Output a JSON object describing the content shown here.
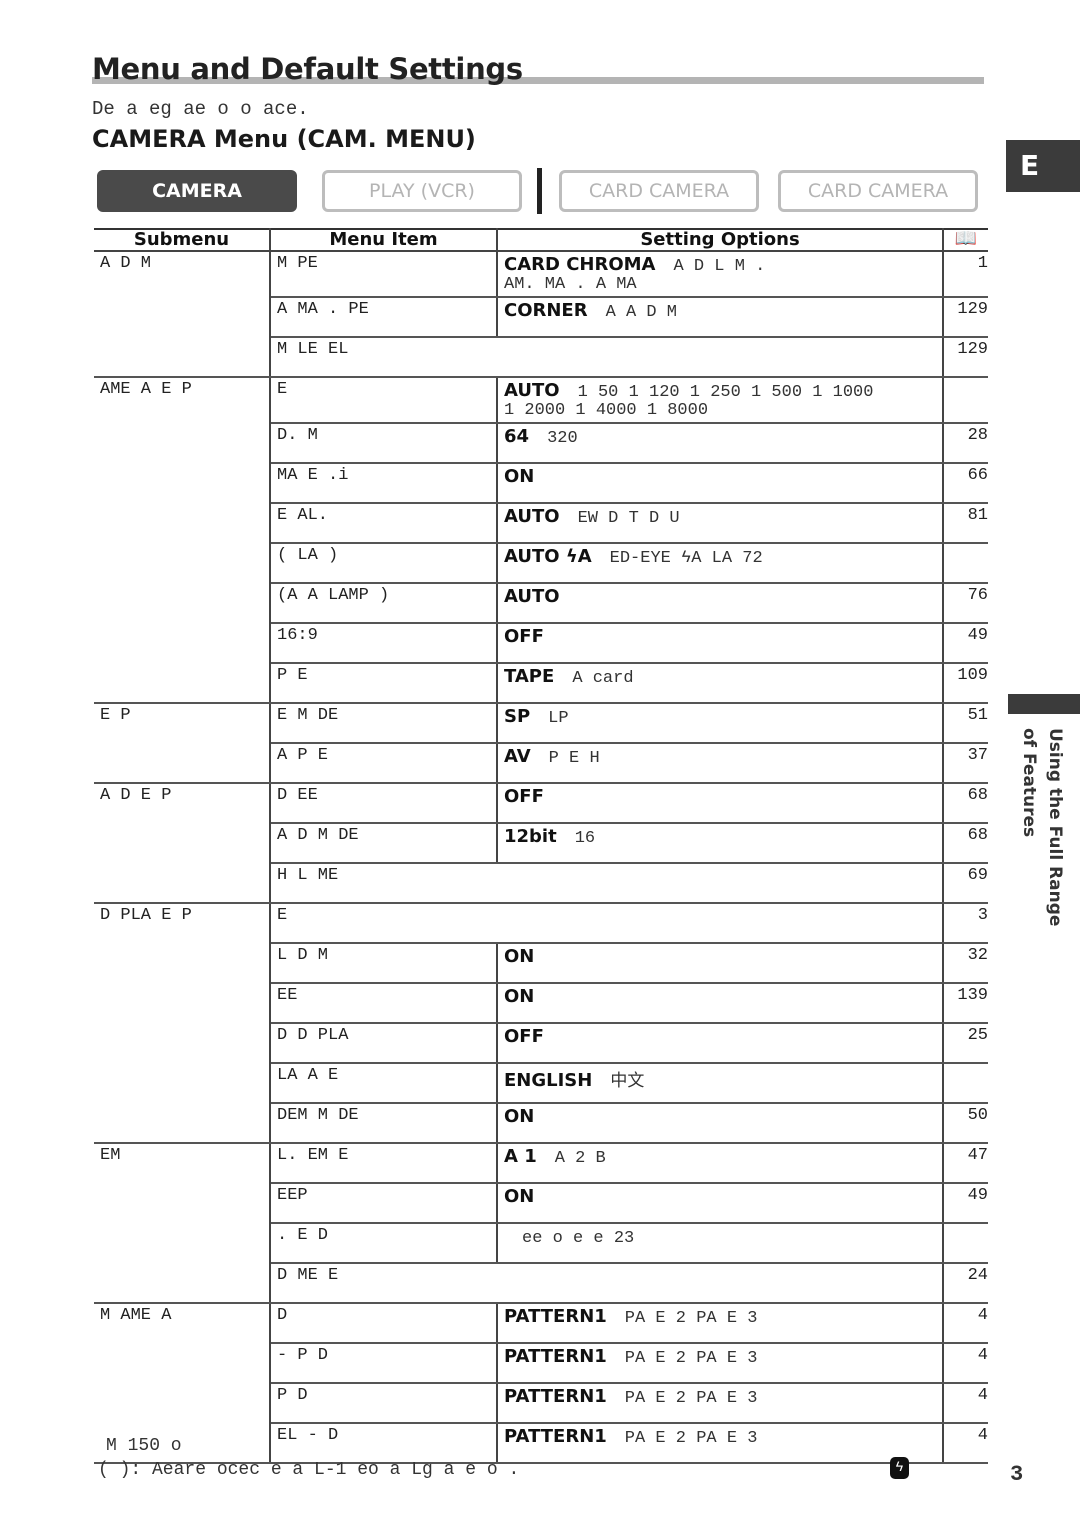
{
  "header": {
    "title": "Menu and Default Settings",
    "subtitle": "De a eg ae o  o ace.",
    "section": "CAMERA Menu (CAM. MENU)"
  },
  "mode_tabs": [
    {
      "label": "CAMERA",
      "active": true
    },
    {
      "label": "PLAY (VCR)",
      "active": false
    },
    {
      "label": "CARD CAMERA",
      "active": false
    },
    {
      "label": "CARD CAMERA",
      "active": false
    }
  ],
  "side": {
    "language_tab": "E",
    "chapter": "Using the Full Range of Features"
  },
  "table": {
    "headers": {
      "submenu": "Submenu",
      "menu_item": "Menu Item",
      "setting_options": "Setting Options",
      "page": "book-icon"
    },
    "groups": [
      {
        "submenu": "A D M",
        "rows": [
          {
            "item": "M     PE",
            "default": "CARD CHROMA",
            "options": "A D L M .",
            "options2": "AM.      MA    . A  MA",
            "page": "1"
          },
          {
            "item": "A  MA .   PE",
            "default": "CORNER",
            "options": "A        A D M",
            "page": "129"
          },
          {
            "item": "M   LE EL",
            "default": "",
            "options": "",
            "page": "129",
            "span": true
          }
        ]
      },
      {
        "submenu": "AME A  E   P",
        "rows": [
          {
            "item": "     E",
            "default": "AUTO",
            "options": "1 50  1 120  1 250  1 500  1 1000",
            "options2": "1 2000  1 4000  1 8000",
            "page": ""
          },
          {
            "item": "D.    M",
            "default": "64",
            "options": "320",
            "page": "28"
          },
          {
            "item": " MA E  .i",
            "default": "ON",
            "options": "",
            "page": "66"
          },
          {
            "item": "    E  AL.",
            "default": "AUTO",
            "options": "EW     D   T      D   U",
            "page": "81"
          },
          {
            "item": "( LA  )",
            "default": "AUTO ϟA",
            "options": "ED-EYE       ϟA          LA 72",
            "page": ""
          },
          {
            "item": "(A  A   LAMP )",
            "default": "AUTO",
            "options": "",
            "page": "76"
          },
          {
            "item": "16:9",
            "default": "OFF",
            "options": "",
            "page": "49"
          },
          {
            "item": "P       E",
            "default": "TAPE",
            "options": "A  card",
            "page": "109"
          }
        ]
      },
      {
        "submenu": "    E   P",
        "rows": [
          {
            "item": "  E  M DE",
            "default": "SP",
            "options": "LP",
            "page": "51"
          },
          {
            "item": "A  P   E",
            "default": "AV",
            "options": "P    E H",
            "page": "37"
          }
        ]
      },
      {
        "submenu": "A D     E   P",
        "rows": [
          {
            "item": "    D    EE",
            "default": "OFF",
            "options": "",
            "page": "68"
          },
          {
            "item": "A D    M DE",
            "default": "12bit",
            "options": "16",
            "page": "68"
          },
          {
            "item": "H   L ME",
            "default": "",
            "options": "",
            "page": "69",
            "span": true
          }
        ]
      },
      {
        "submenu": "D  PLA    E   P",
        "rows": [
          {
            "item": "         E",
            "default": "",
            "options": "",
            "page": "3",
            "span": true
          },
          {
            "item": "L D M",
            "default": "ON",
            "options": "",
            "page": "32"
          },
          {
            "item": "       EE",
            "default": "ON",
            "options": "",
            "page": "139"
          },
          {
            "item": "D   D  PLA",
            "default": "OFF",
            "options": "",
            "page": "25"
          },
          {
            "item": "LA    A E",
            "default": "ENGLISH",
            "options": "中文",
            "page": ""
          },
          {
            "item": "DEM  M DE",
            "default": "ON",
            "options": "",
            "page": "50"
          }
        ]
      },
      {
        "submenu": "    EM",
        "rows": [
          {
            "item": " L.  EM  E",
            "default": "A  1",
            "options": "A  2     B",
            "page": "47"
          },
          {
            "item": " EEP",
            "default": "ON",
            "options": "",
            "page": "49"
          },
          {
            "item": " .   E D",
            "default": "",
            "options": "  ee  o e e                        23",
            "page": ""
          },
          {
            "item": "D   ME  E",
            "default": "",
            "options": "",
            "page": "24",
            "span": true
          }
        ]
      },
      {
        "submenu": "M   AME A",
        "rows": [
          {
            "item": "          D",
            "default": "PATTERN1",
            "options": "PA  E  2  PA  E  3",
            "page": "4"
          },
          {
            "item": " - P     D",
            "default": "PATTERN1",
            "options": "PA  E  2  PA  E  3",
            "page": "4"
          },
          {
            "item": "    P     D",
            "default": "PATTERN1",
            "options": "PA  E  2  PA  E  3",
            "page": "4"
          },
          {
            "item": " EL -      D",
            "default": "PATTERN1",
            "options": "PA  E  2  PA  E  3",
            "page": "4"
          }
        ]
      }
    ]
  },
  "footer": {
    "note1": "M  150 o",
    "note2": "(     ): Aeare ocec e a   L-1   eo a Lg a  e  o       .",
    "page_number": "3"
  }
}
